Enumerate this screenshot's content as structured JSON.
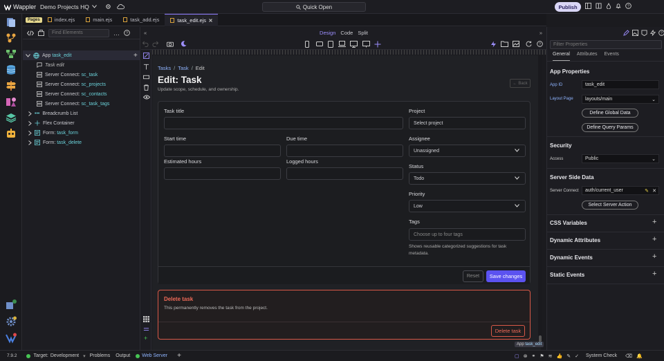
{
  "app": {
    "brand": "Wappler",
    "project": "Demo Projects HQ",
    "quick_open": "Quick Open",
    "publish": "Publish"
  },
  "tabs": {
    "pages_badge": "Pages",
    "items": [
      {
        "label": "index.ejs"
      },
      {
        "label": "main.ejs"
      },
      {
        "label": "task_add.ejs"
      },
      {
        "label": "task_edit.ejs"
      }
    ]
  },
  "structure": {
    "find_placeholder": "Find Elements",
    "tree": [
      {
        "kind": "App",
        "name": "task_edit"
      },
      {
        "kind": "",
        "name": "Task edit"
      },
      {
        "kind": "Server Connect:",
        "name": "sc_task"
      },
      {
        "kind": "Server Connect:",
        "name": "sc_projects"
      },
      {
        "kind": "Server Connect:",
        "name": "sc_contacts"
      },
      {
        "kind": "Server Connect:",
        "name": "sc_task_tags"
      },
      {
        "kind": "Breadcrumb List",
        "name": ""
      },
      {
        "kind": "Flex Container",
        "name": ""
      },
      {
        "kind": "Form:",
        "name": "task_form"
      },
      {
        "kind": "Form:",
        "name": "task_delete"
      }
    ]
  },
  "design": {
    "modes": [
      "Design",
      "Code",
      "Split"
    ],
    "active_mode": "Design"
  },
  "canvas": {
    "breadcrumb": [
      "Tasks",
      "Task",
      "Edit"
    ],
    "title": "Edit: Task",
    "subtitle": "Update scope, schedule, and ownership.",
    "back": "Back",
    "form": {
      "task_title": {
        "label": "Task title",
        "value": ""
      },
      "start_time": {
        "label": "Start time",
        "value": ""
      },
      "due_time": {
        "label": "Due time",
        "value": ""
      },
      "estimated_hours": {
        "label": "Estimated hours",
        "value": ""
      },
      "logged_hours": {
        "label": "Logged hours",
        "value": ""
      },
      "project": {
        "label": "Project",
        "placeholder": "Select project"
      },
      "assignee": {
        "label": "Assignee",
        "value": "Unassigned"
      },
      "status": {
        "label": "Status",
        "value": "Todo"
      },
      "priority": {
        "label": "Priority",
        "value": "Low"
      },
      "tags": {
        "label": "Tags",
        "placeholder": "Choose up to four tags",
        "help": "Shows reusable categorized suggestions for task metadata."
      },
      "reset": "Reset",
      "save": "Save changes"
    },
    "danger": {
      "title": "Delete task",
      "text": "This permanently removes the task from the project.",
      "button": "Delete task"
    },
    "app_tag_kind": "App",
    "app_tag_name": "task_edit"
  },
  "properties": {
    "filter_placeholder": "Filter Properties",
    "tabs": [
      "General",
      "Attributes",
      "Events"
    ],
    "app_properties": "App Properties",
    "app_id_label": "App ID",
    "app_id": "task_edit",
    "layout_label": "Layout Page",
    "layout": "layouts/main",
    "define_global": "Define Global Data",
    "define_query": "Define Query Params",
    "security": "Security",
    "access_label": "Access",
    "access": "Public",
    "server_side": "Server Side Data",
    "sc_label": "Server Connect",
    "sc_value": "auth/current_user",
    "select_action": "Select Server Action",
    "css_vars": "CSS Variables",
    "dyn_attrs": "Dynamic Attributes",
    "dyn_events": "Dynamic Events",
    "static_events": "Static Events"
  },
  "status": {
    "version": "7.9.2",
    "target_label": "Target:",
    "target": "Development",
    "problems": "Problems",
    "output": "Output",
    "web_server": "Web Server",
    "system_check": "System Check"
  },
  "colors": {
    "accent": "#5b52f0",
    "danger": "#ef6a58",
    "link": "#8fb4ff",
    "ok": "#47c454"
  }
}
